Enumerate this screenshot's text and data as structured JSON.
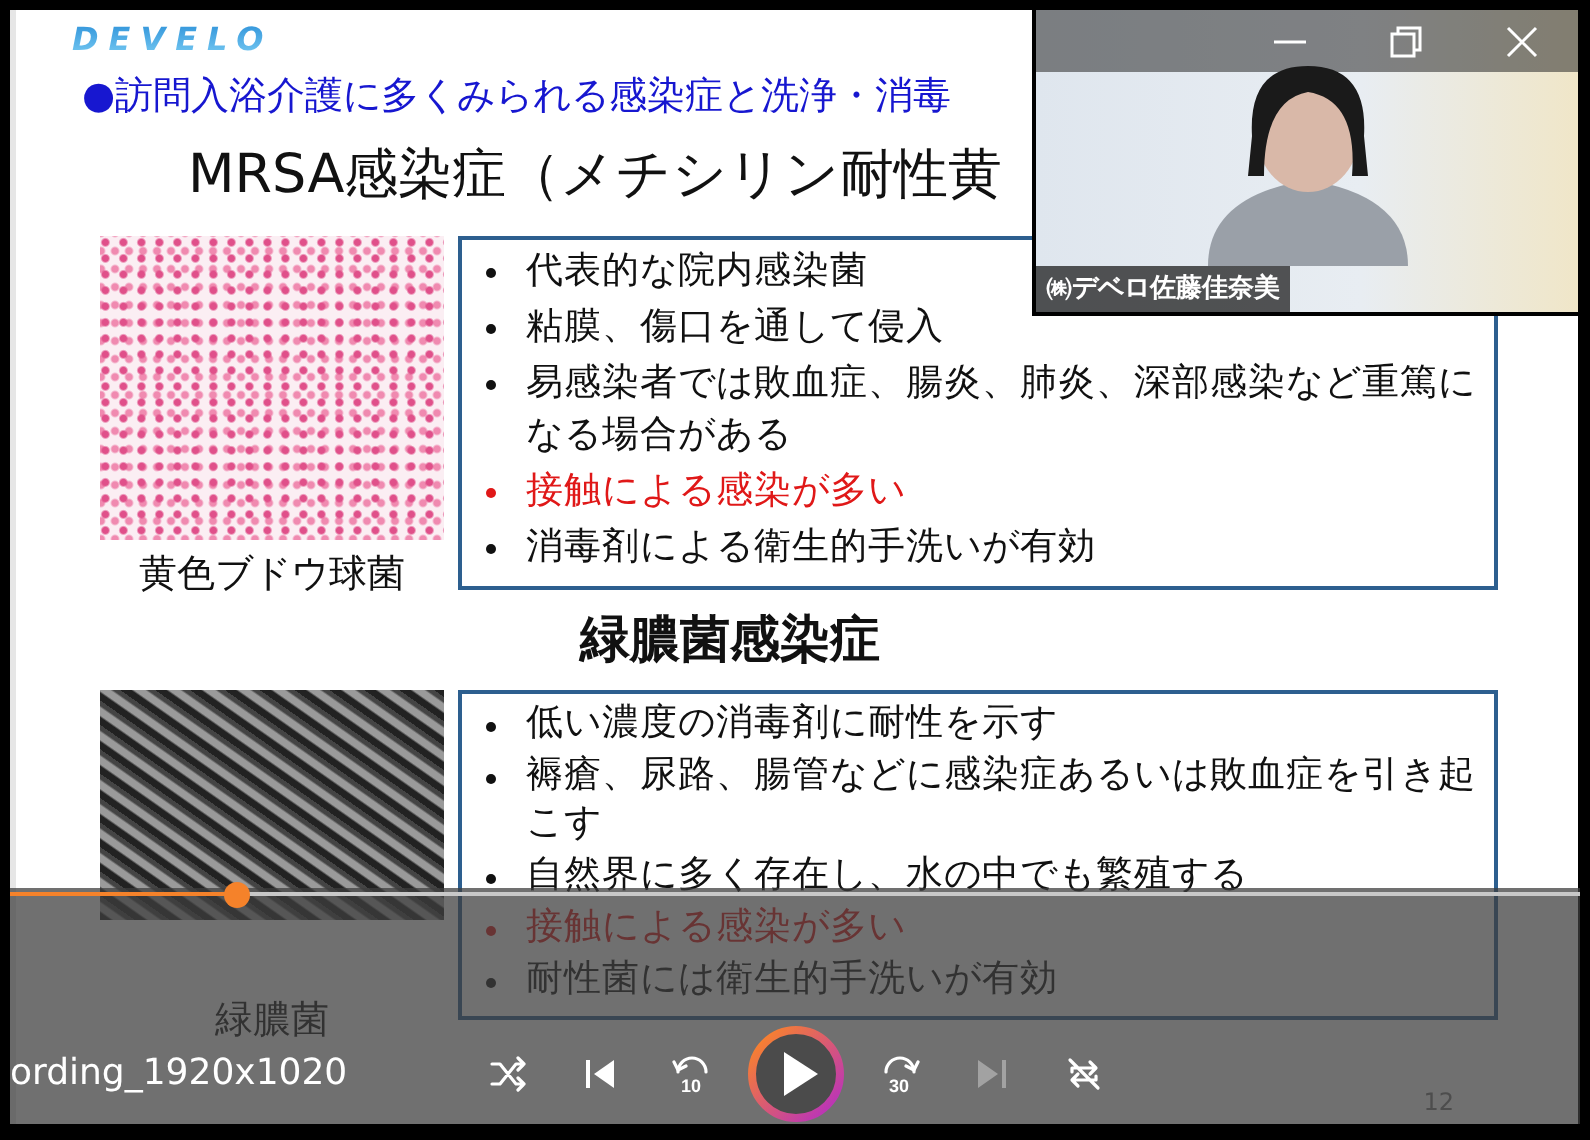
{
  "slide": {
    "logo": "DEVELO",
    "heading": "●訪問入浴介護に多くみられる感染症と洗浄・消毒",
    "sections": [
      {
        "title": "MRSA感染症（メチシリン耐性黄",
        "image": {
          "kind": "stained",
          "caption": "黄色ブドウ球菌"
        },
        "bullets": [
          {
            "text": "代表的な院内感染菌",
            "emphasis": false
          },
          {
            "text": "粘膜、傷口を通して侵入",
            "emphasis": false
          },
          {
            "text": "易感染者では敗血症、腸炎、肺炎、深部感染など重篤になる場合がある",
            "emphasis": false
          },
          {
            "text": "接触による感染が多い",
            "emphasis": true
          },
          {
            "text": "消毒剤による衛生的手洗いが有効",
            "emphasis": false
          }
        ]
      },
      {
        "title": "緑膿菌感染症",
        "image": {
          "kind": "electron",
          "caption": "緑膿菌"
        },
        "bullets": [
          {
            "text": "低い濃度の消毒剤に耐性を示す",
            "emphasis": false
          },
          {
            "text": "褥瘡、尿路、腸管などに感染症あるいは敗血症を引き起こす",
            "emphasis": false
          },
          {
            "text": "自然界に多く存在し、水の中でも繁殖する",
            "emphasis": false
          },
          {
            "text": "接触による感染が多い",
            "emphasis": true
          },
          {
            "text": "耐性菌には衛生的手洗いが有効",
            "emphasis": false
          }
        ]
      }
    ],
    "page_number": "12"
  },
  "webcam": {
    "name_label": "㈱デベロ佐藤佳奈美",
    "window_buttons": [
      {
        "kind": "minimize"
      },
      {
        "kind": "restore"
      },
      {
        "kind": "close"
      }
    ]
  },
  "player": {
    "file_title": "ording_1920x1020",
    "progress": {
      "level": 0.145
    },
    "controls": [
      {
        "kind": "shuffle",
        "disabled": false
      },
      {
        "kind": "previous",
        "disabled": false
      },
      {
        "kind": "rewind",
        "label": "10",
        "disabled": false
      },
      {
        "kind": "play",
        "disabled": false
      },
      {
        "kind": "forward",
        "label": "30",
        "disabled": false
      },
      {
        "kind": "next",
        "disabled": true
      },
      {
        "kind": "repeat",
        "disabled": false
      }
    ]
  }
}
